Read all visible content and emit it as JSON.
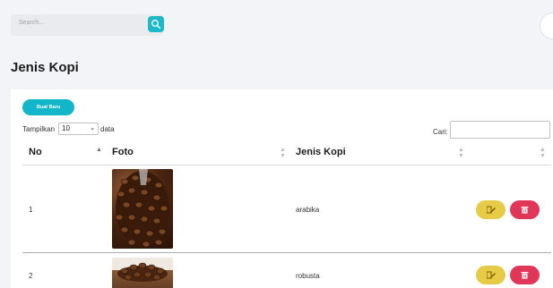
{
  "topbar": {
    "search_placeholder": "Search..."
  },
  "page": {
    "title": "Jenis Kopi"
  },
  "toolbar": {
    "new_button_label": "Buat Baru",
    "show_label": "Tampilkan",
    "page_length": "10",
    "show_suffix": "data",
    "search_label": "Cari:"
  },
  "table": {
    "columns": [
      "No",
      "Foto",
      "Jenis Kopi",
      ""
    ],
    "rows": [
      {
        "no": "1",
        "jenis": "arabika"
      },
      {
        "no": "2",
        "jenis": "robusta"
      }
    ]
  },
  "colors": {
    "accent": "#12b6c8",
    "edit": "#e6cb46",
    "delete": "#e13658"
  },
  "icons": [
    "search-icon",
    "edit-icon",
    "trash-icon",
    "sort-icon"
  ]
}
